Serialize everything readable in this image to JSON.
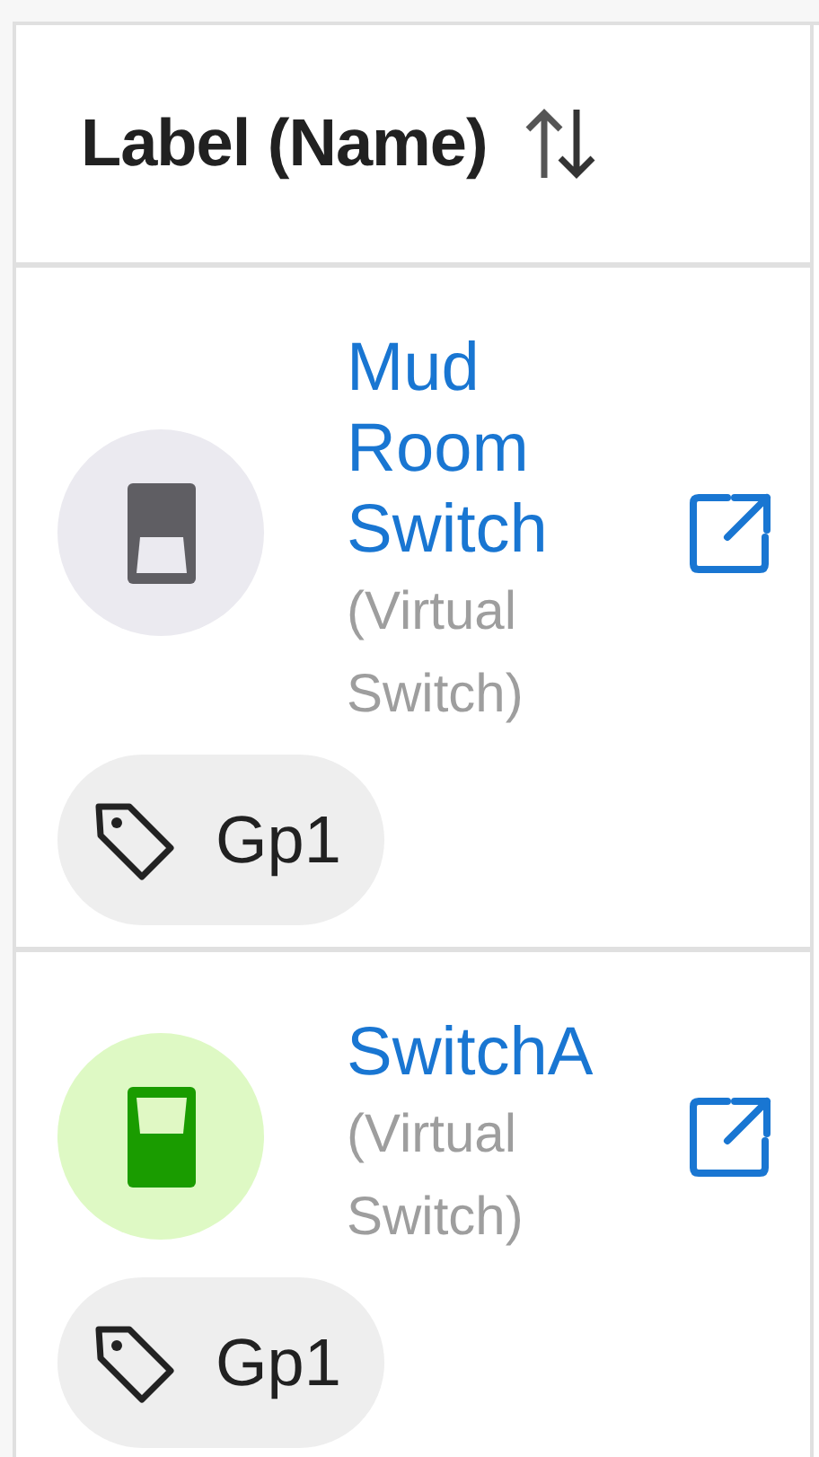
{
  "table": {
    "column": {
      "label": "Label (Name)"
    },
    "rows": [
      {
        "name": "Mud Room Switch",
        "type": "(Virtual Switch)",
        "on": false,
        "tags": [
          "Gp1"
        ]
      },
      {
        "name": "SwitchA",
        "type": "(Virtual Switch)",
        "on": true,
        "tags": [
          "Gp1"
        ]
      }
    ]
  }
}
